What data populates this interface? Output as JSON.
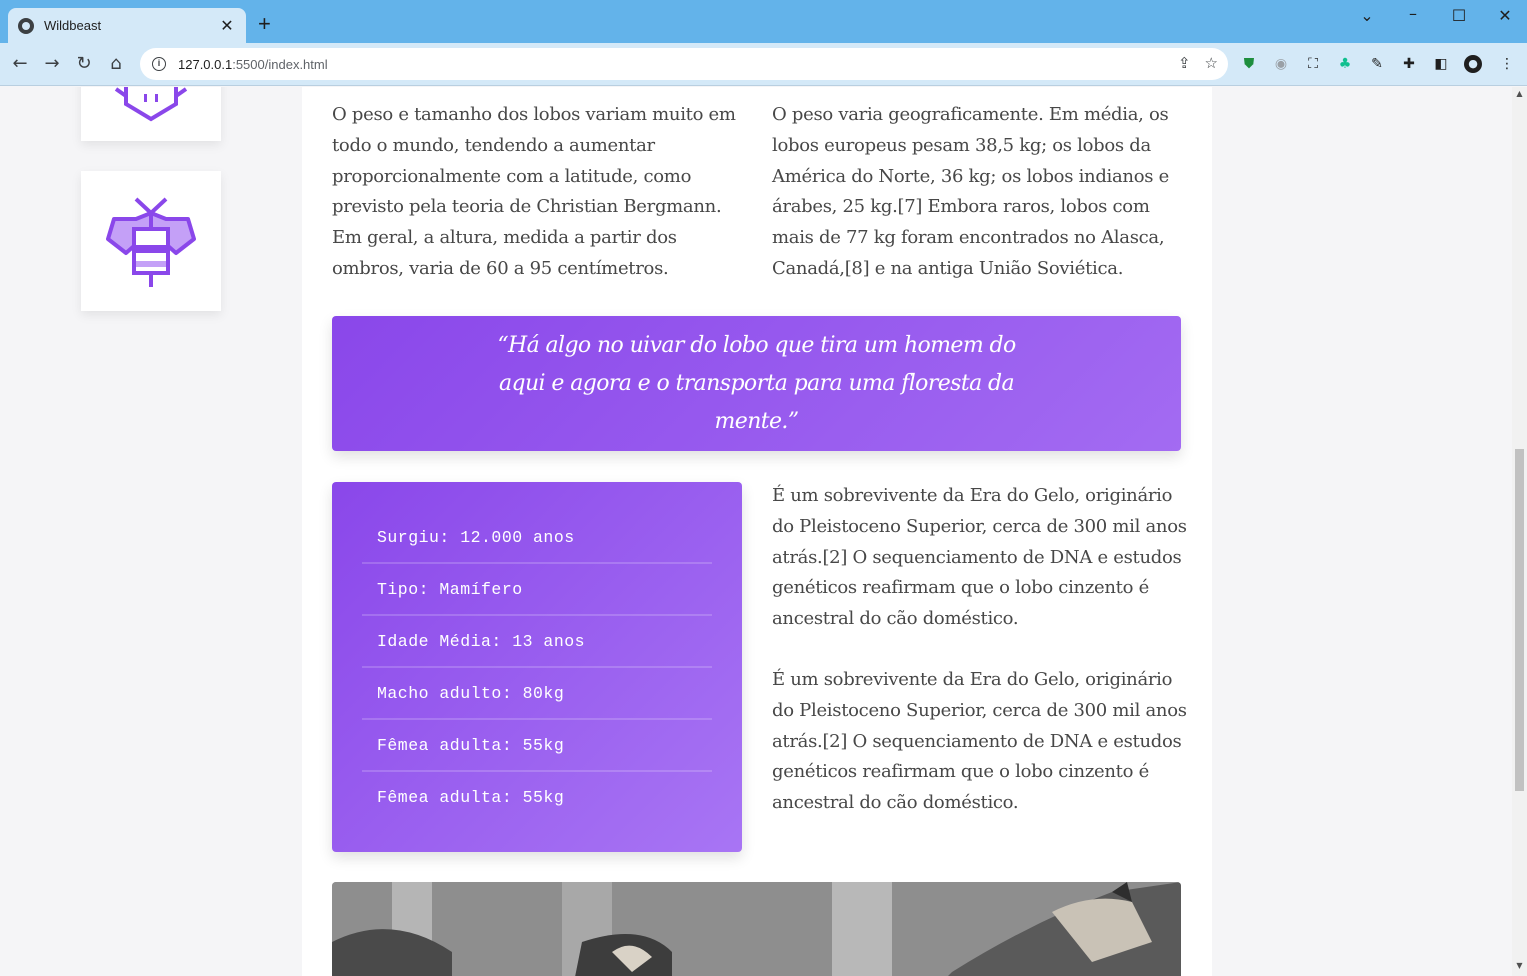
{
  "browser": {
    "tab_title": "Wildbeast",
    "url_host": "127.0.0.1",
    "url_rest": ":5500/index.html",
    "new_tab": "+",
    "close_tab": "✕"
  },
  "article": {
    "col_left": "O peso e tamanho dos lobos variam muito em todo o mundo, tendendo a aumentar proporcionalmente com a latitude, como previsto pela teoria de Christian Bergmann. Em geral, a altura, medida a partir dos ombros, varia de 60 a 95 centímetros.",
    "col_right": "O peso varia geograficamente. Em média, os lobos europeus pesam 38,5 kg; os lobos da América do Norte, 36 kg; os lobos indianos e árabes, 25 kg.[7] Embora raros, lobos com mais de 77 kg foram encontrados no Alasca, Canadá,[8] e na antiga União Soviética.",
    "quote": "“Há algo no uivar do lobo que tira um homem do aqui e agora e o transporta para uma floresta da mente.”",
    "facts": [
      "Surgiu: 12.000 anos",
      "Tipo: Mamífero",
      "Idade Média: 13 anos",
      "Macho adulto: 80kg",
      "Fêmea adulta: 55kg",
      "Fêmea adulta: 55kg"
    ],
    "para_1": "É um sobrevivente da Era do Gelo, originário do Pleistoceno Superior, cerca de 300 mil anos atrás.[2] O sequenciamento de DNA e estudos genéticos reafirmam que o lobo cinzento é ancestral do cão doméstico.",
    "para_2": "É um sobrevivente da Era do Gelo, originário do Pleistoceno Superior, cerca de 300 mil anos atrás.[2] O sequenciamento de DNA e estudos genéticos reafirmam que o lobo cinzento é ancestral do cão doméstico."
  },
  "colors": {
    "accent": "#8a47ea",
    "accent_light": "#a875f4",
    "titlebar": "#63b3ea",
    "toolbar": "#d4e9f8"
  },
  "icons": [
    "bee-icon",
    "pig-icon"
  ]
}
